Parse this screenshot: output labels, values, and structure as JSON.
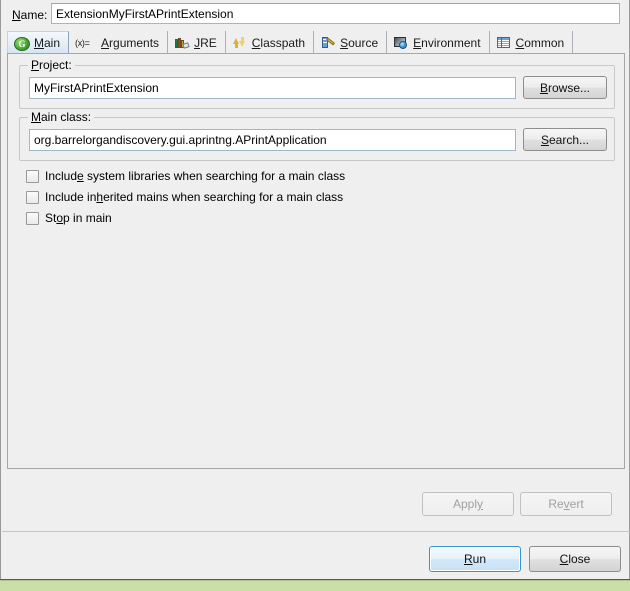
{
  "dialog": {
    "name_label": "Name:",
    "name_label_mnemonic": "N",
    "name_value": "ExtensionMyFirstAPrintExtension"
  },
  "tabs": [
    {
      "label": "Main",
      "mnemonic": "M",
      "icon": "java-main-class-icon",
      "selected": true
    },
    {
      "label": "Arguments",
      "mnemonic": "A",
      "icon": "variables-icon",
      "selected": false
    },
    {
      "label": "JRE",
      "mnemonic": "J",
      "icon": "jre-books-icon",
      "selected": false
    },
    {
      "label": "Classpath",
      "mnemonic": "C",
      "icon": "classpath-arrows-icon",
      "selected": false
    },
    {
      "label": "Source",
      "mnemonic": "S",
      "icon": "source-edit-icon",
      "selected": false
    },
    {
      "label": "Environment",
      "mnemonic": "E",
      "icon": "environment-icon",
      "selected": false
    },
    {
      "label": "Common",
      "mnemonic": "C",
      "icon": "common-list-icon",
      "selected": false
    }
  ],
  "main_tab": {
    "project": {
      "group_label": "Project:",
      "group_label_mnemonic": "P",
      "value": "MyFirstAPrintExtension",
      "browse_label": "Browse...",
      "browse_mnemonic": "B"
    },
    "main_class": {
      "group_label": "Main class:",
      "group_label_mnemonic": "M",
      "value": "org.barrelorgandiscovery.gui.aprintng.APrintApplication",
      "search_label": "Search...",
      "search_mnemonic": "S"
    },
    "checkboxes": [
      {
        "label_before": "Includ",
        "mnemonic": "e",
        "label_after": " system libraries when searching for a main class",
        "checked": false
      },
      {
        "label_before": "Include in",
        "mnemonic": "h",
        "label_after": "erited mains when searching for a main class",
        "checked": false
      },
      {
        "label_before": "St",
        "mnemonic": "o",
        "label_after": "p in main",
        "checked": false
      }
    ]
  },
  "footer": {
    "apply_before": "Appl",
    "apply_mnemonic": "y",
    "apply_after": "",
    "apply_enabled": false,
    "revert_before": "Re",
    "revert_mnemonic": "v",
    "revert_after": "ert",
    "revert_enabled": false,
    "run_before": "",
    "run_mnemonic": "R",
    "run_after": "un",
    "close_before": "",
    "close_mnemonic": "C",
    "close_after": "lose"
  },
  "colors": {
    "dialog_bg": "#efefef",
    "field_border": "#9fb6cd",
    "default_button_border": "#3c93d4",
    "desktop_strip": "#cadfa8"
  }
}
